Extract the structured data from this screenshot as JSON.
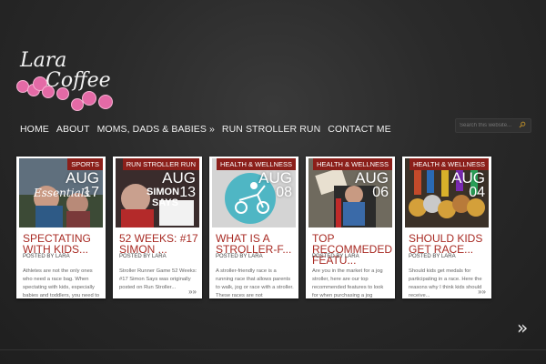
{
  "logo": {
    "line1": "Lara",
    "line2": "Coffee",
    "accent_color": "#e46aa6"
  },
  "nav": [
    "HOME",
    "ABOUT",
    "MOMS, DADS & BABIES »",
    "RUN STROLLER RUN",
    "CONTACT ME"
  ],
  "search": {
    "placeholder": "Search this website..."
  },
  "posts": [
    {
      "category": "SPORTS",
      "month": "AUG",
      "day": "17",
      "title": "SPECTATING WITH KIDS...",
      "byline": "POSTED BY LARA",
      "excerpt": "Athletes are not the only ones who need a race bag. When spectating with kids, especially babies and toddlers, you need to",
      "more": ""
    },
    {
      "category": "RUN STROLLER RUN",
      "month": "AUG",
      "day": "13",
      "title": "52 WEEKS: #17 SIMON ...",
      "byline": "POSTED BY LARA",
      "excerpt": "Stroller Runner Game 52 Weeks: #17 Simon Says was originally posted on Run Stroller...",
      "more": "»»"
    },
    {
      "category": "HEALTH & WELLNESS",
      "month": "AUG",
      "day": "08",
      "title": "WHAT IS A STROLLER-F...",
      "byline": "POSTED BY LARA",
      "excerpt": "A stroller-friendly race is a running race that allows parents to walk, jog or race with a stroller. These races are not",
      "more": ""
    },
    {
      "category": "HEALTH & WELLNESS",
      "month": "AUG",
      "day": "06",
      "title": "TOP RECOMMEDED FEATU...",
      "byline": "POSTED BY LARA",
      "excerpt": "Are you in the market for a jog stroller, here are our top recommended features to look for when purchasing a jog",
      "more": ""
    },
    {
      "category": "HEALTH & WELLNESS",
      "month": "AUG",
      "day": "04",
      "title": "SHOULD KIDS GET RACE...",
      "byline": "POSTED BY LARA",
      "excerpt": "Should kids get medals for participating in a race. Here the reasons why I think kids should receive...",
      "more": "»»"
    }
  ],
  "next_arrow": "»",
  "colors": {
    "category_bg": "#8b1f1a",
    "title": "#a82a23"
  }
}
